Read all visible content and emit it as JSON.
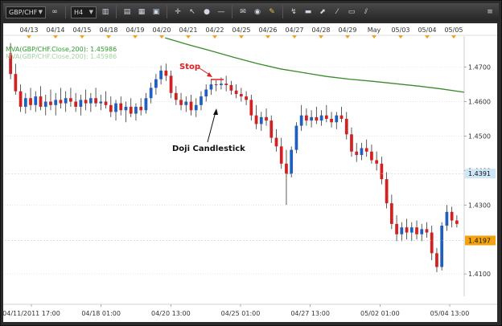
{
  "toolbar": {
    "symbol": "GBP/CHF",
    "timeframe": "H4",
    "icons": [
      "link-icon",
      "bar-chart-icon",
      "candles-icon",
      "line-chart-icon",
      "layers-icon",
      "crosshair-icon",
      "cursor-icon",
      "dot-icon",
      "horizontal-line-icon",
      "comment-icon",
      "globe-icon",
      "pencil-icon",
      "indicator-icon",
      "currency-icon",
      "trend-icon",
      "fibonacci-icon",
      "channel-icon",
      "pitchfork-icon",
      "menu-icon"
    ]
  },
  "chart_data": {
    "type": "candlestick",
    "top_dates": [
      "04/13",
      "04/14",
      "04/15",
      "04/18",
      "04/19",
      "04/20",
      "04/21",
      "04/22",
      "04/25",
      "04/26",
      "04/27",
      "04/28",
      "04/29",
      "May",
      "05/03",
      "05/04",
      "05/05"
    ],
    "bottom_labels": [
      "04/11/2011 17:00",
      "04/18 01:00",
      "04/20 13:00",
      "04/25 01:00",
      "04/27 13:00",
      "05/02 01:00",
      "05/04 13:00"
    ],
    "y_ticks": [
      "1.4700",
      "1.4600",
      "1.4500",
      "1.4400",
      "1.4300",
      "1.4100"
    ],
    "ylim": [
      1.4035,
      1.479
    ],
    "price_tags": [
      {
        "value": 1.4391,
        "label": "1.4391",
        "color": "#cfe6f7"
      },
      {
        "value": 1.4197,
        "label": "1.4197",
        "color": "#f2a30f"
      }
    ],
    "legend": [
      {
        "text": "MVA(GBP/CHF.Close,200): 1.45986",
        "color": "#2f9b2f"
      },
      {
        "text": "MVA(GBP/CHF.Close,200): 1.45986",
        "color": "#9ed49e"
      }
    ],
    "annotations": {
      "stop": "Stop",
      "doji": "Doji Candlestick"
    },
    "ma": [
      [
        0.349,
        1.4785
      ],
      [
        0.4,
        1.4765
      ],
      [
        0.45,
        1.4747
      ],
      [
        0.5,
        1.4728
      ],
      [
        0.55,
        1.471
      ],
      [
        0.6,
        1.4695
      ],
      [
        0.65,
        1.4684
      ],
      [
        0.7,
        1.4673
      ],
      [
        0.75,
        1.4665
      ],
      [
        0.8,
        1.4659
      ],
      [
        0.85,
        1.4652
      ],
      [
        0.9,
        1.4645
      ],
      [
        0.95,
        1.4637
      ],
      [
        1.0,
        1.4627
      ]
    ],
    "candles": [
      [
        1.474,
        1.477,
        1.4665,
        1.468
      ],
      [
        1.468,
        1.471,
        1.462,
        1.463
      ],
      [
        1.463,
        1.465,
        1.457,
        1.4585
      ],
      [
        1.4585,
        1.4625,
        1.4565,
        1.461
      ],
      [
        1.461,
        1.464,
        1.4575,
        1.459
      ],
      [
        1.459,
        1.463,
        1.457,
        1.4615
      ],
      [
        1.4615,
        1.4645,
        1.4575,
        1.4585
      ],
      [
        1.4585,
        1.462,
        1.456,
        1.46
      ],
      [
        1.46,
        1.4635,
        1.4575,
        1.459
      ],
      [
        1.459,
        1.4625,
        1.456,
        1.4605
      ],
      [
        1.4605,
        1.464,
        1.458,
        1.4595
      ],
      [
        1.4595,
        1.463,
        1.457,
        1.461
      ],
      [
        1.461,
        1.464,
        1.4585,
        1.46
      ],
      [
        1.46,
        1.4625,
        1.457,
        1.4585
      ],
      [
        1.4585,
        1.462,
        1.456,
        1.4605
      ],
      [
        1.4605,
        1.4635,
        1.4575,
        1.4595
      ],
      [
        1.4595,
        1.4625,
        1.457,
        1.461
      ],
      [
        1.461,
        1.464,
        1.4585,
        1.4595
      ],
      [
        1.4595,
        1.462,
        1.4575,
        1.46
      ],
      [
        1.46,
        1.463,
        1.458,
        1.459
      ],
      [
        1.459,
        1.4615,
        1.4555,
        1.457
      ],
      [
        1.457,
        1.4605,
        1.4545,
        1.4595
      ],
      [
        1.4595,
        1.4615,
        1.456,
        1.4575
      ],
      [
        1.4575,
        1.46,
        1.454,
        1.4585
      ],
      [
        1.4585,
        1.461,
        1.4555,
        1.4565
      ],
      [
        1.4565,
        1.4595,
        1.4545,
        1.4585
      ],
      [
        1.4585,
        1.461,
        1.456,
        1.4575
      ],
      [
        1.4575,
        1.4625,
        1.4565,
        1.461
      ],
      [
        1.461,
        1.4655,
        1.4595,
        1.464
      ],
      [
        1.464,
        1.468,
        1.462,
        1.4665
      ],
      [
        1.4665,
        1.4705,
        1.465,
        1.469
      ],
      [
        1.469,
        1.471,
        1.466,
        1.4675
      ],
      [
        1.4675,
        1.469,
        1.461,
        1.4625
      ],
      [
        1.4625,
        1.4645,
        1.459,
        1.4605
      ],
      [
        1.4605,
        1.4625,
        1.4575,
        1.459
      ],
      [
        1.459,
        1.4615,
        1.457,
        1.46
      ],
      [
        1.46,
        1.462,
        1.456,
        1.4575
      ],
      [
        1.4575,
        1.461,
        1.4555,
        1.459
      ],
      [
        1.459,
        1.463,
        1.4575,
        1.4615
      ],
      [
        1.4615,
        1.465,
        1.46,
        1.4635
      ],
      [
        1.4635,
        1.4665,
        1.462,
        1.465
      ],
      [
        1.465,
        1.4662,
        1.463,
        1.4648
      ],
      [
        1.4648,
        1.467,
        1.4635,
        1.4652
      ],
      [
        1.4652,
        1.4675,
        1.463,
        1.4648
      ],
      [
        1.4648,
        1.466,
        1.462,
        1.4632
      ],
      [
        1.4632,
        1.465,
        1.461,
        1.4622
      ],
      [
        1.4622,
        1.464,
        1.46,
        1.4615
      ],
      [
        1.4615,
        1.463,
        1.459,
        1.4605
      ],
      [
        1.4605,
        1.462,
        1.4545,
        1.456
      ],
      [
        1.456,
        1.459,
        1.452,
        1.4535
      ],
      [
        1.4535,
        1.457,
        1.4515,
        1.4555
      ],
      [
        1.4555,
        1.458,
        1.453,
        1.4545
      ],
      [
        1.4545,
        1.456,
        1.448,
        1.4495
      ],
      [
        1.4495,
        1.452,
        1.4455,
        1.447
      ],
      [
        1.447,
        1.4495,
        1.4405,
        1.442
      ],
      [
        1.442,
        1.446,
        1.43,
        1.439
      ],
      [
        1.439,
        1.447,
        1.438,
        1.446
      ],
      [
        1.446,
        1.454,
        1.445,
        1.453
      ],
      [
        1.453,
        1.459,
        1.4515,
        1.456
      ],
      [
        1.456,
        1.458,
        1.453,
        1.4545
      ],
      [
        1.4545,
        1.4575,
        1.4525,
        1.4555
      ],
      [
        1.4555,
        1.4585,
        1.4535,
        1.4545
      ],
      [
        1.4545,
        1.4575,
        1.453,
        1.456
      ],
      [
        1.456,
        1.459,
        1.454,
        1.455
      ],
      [
        1.455,
        1.457,
        1.4525,
        1.454
      ],
      [
        1.454,
        1.457,
        1.452,
        1.456
      ],
      [
        1.456,
        1.4585,
        1.454,
        1.455
      ],
      [
        1.455,
        1.457,
        1.449,
        1.4505
      ],
      [
        1.4505,
        1.4525,
        1.444,
        1.4455
      ],
      [
        1.4455,
        1.448,
        1.4425,
        1.4445
      ],
      [
        1.4445,
        1.448,
        1.443,
        1.4465
      ],
      [
        1.4465,
        1.449,
        1.444,
        1.4455
      ],
      [
        1.4455,
        1.4475,
        1.442,
        1.443
      ],
      [
        1.443,
        1.4455,
        1.44,
        1.442
      ],
      [
        1.442,
        1.444,
        1.436,
        1.4375
      ],
      [
        1.4375,
        1.4395,
        1.429,
        1.4305
      ],
      [
        1.4305,
        1.433,
        1.423,
        1.4245
      ],
      [
        1.4245,
        1.427,
        1.4195,
        1.4215
      ],
      [
        1.4215,
        1.425,
        1.4195,
        1.4235
      ],
      [
        1.4235,
        1.426,
        1.42,
        1.422
      ],
      [
        1.422,
        1.425,
        1.4195,
        1.4235
      ],
      [
        1.4235,
        1.4255,
        1.42,
        1.4215
      ],
      [
        1.4215,
        1.4245,
        1.4195,
        1.423
      ],
      [
        1.423,
        1.425,
        1.4205,
        1.422
      ],
      [
        1.422,
        1.424,
        1.414,
        1.416
      ],
      [
        1.416,
        1.4175,
        1.4105,
        1.412
      ],
      [
        1.412,
        1.425,
        1.411,
        1.424
      ],
      [
        1.424,
        1.43,
        1.4225,
        1.428
      ],
      [
        1.428,
        1.4295,
        1.4235,
        1.4255
      ],
      [
        1.4255,
        1.427,
        1.4235,
        1.4245
      ]
    ]
  }
}
